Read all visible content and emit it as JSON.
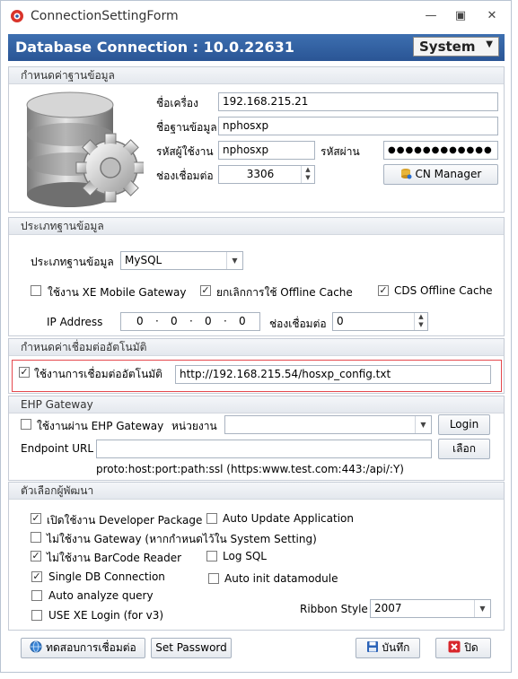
{
  "window": {
    "title": "ConnectionSettingForm",
    "banner_title": "Database Connection : 10.0.22631",
    "system_select": "System"
  },
  "db_settings": {
    "header": "กำหนดค่าฐานข้อมูล",
    "host_label": "ชื่อเครื่อง",
    "host_value": "192.168.215.21",
    "dbname_label": "ชื่อฐานข้อมูล",
    "dbname_value": "nphosxp",
    "user_label": "รหัสผู้ใช้งาน",
    "user_value": "nphosxp",
    "password_label": "รหัสผ่าน",
    "password_value": "●●●●●●●●●●●●",
    "port_label": "ช่องเชื่อมต่อ",
    "port_value": "3306",
    "cn_manager_button": "CN Manager"
  },
  "db_type": {
    "header": "ประเภทฐานข้อมูล",
    "type_label": "ประเภทฐานข้อมูล",
    "type_value": "MySQL",
    "xe_mobile_label": "ใช้งาน XE Mobile Gateway",
    "xe_mobile_checked": false,
    "cancel_offline_label": "ยกเลิกการใช้ Offline Cache",
    "cancel_offline_checked": true,
    "cds_offline_label": "CDS Offline Cache",
    "cds_offline_checked": true,
    "ip_label": "IP Address",
    "ip_octets": [
      "0",
      "0",
      "0",
      "0"
    ],
    "port_label": "ช่องเชื่อมต่อ",
    "port_value": "0"
  },
  "auto_config": {
    "header": "กำหนดค่าเชื่อมต่ออัตโนมัติ",
    "enable_label": "ใช้งานการเชื่อมต่ออัตโนมัติ",
    "enable_checked": true,
    "url_value": "http://192.168.215.54/hosxp_config.txt"
  },
  "ehp": {
    "header": "EHP Gateway",
    "use_label": "ใช้งานผ่าน EHP Gateway",
    "use_checked": false,
    "unit_label": "หน่วยงาน",
    "unit_value": "",
    "login_button": "Login",
    "endpoint_label": "Endpoint URL",
    "endpoint_value": "",
    "select_button": "เลือก",
    "hint": "proto:host:port:path:ssl (https:www.test.com:443:/api/:Y)"
  },
  "dev_options": {
    "header": "ตัวเลือกผู้พัฒนา",
    "items": [
      {
        "label": "เปิดใช้งาน Developer Package",
        "checked": true
      },
      {
        "label": "ไม่ใช้งาน Gateway (หากกำหนดไว้ใน System Setting)",
        "checked": false
      },
      {
        "label": "ไม่ใช้งาน BarCode Reader",
        "checked": true
      },
      {
        "label": "Single DB Connection",
        "checked": true
      },
      {
        "label": "Auto analyze query",
        "checked": false
      },
      {
        "label": "USE XE Login (for v3)",
        "checked": false
      },
      {
        "label": "Auto Update Application",
        "checked": false
      },
      {
        "label": "Log SQL",
        "checked": false
      },
      {
        "label": "Auto init datamodule",
        "checked": false
      }
    ],
    "ribbon_label": "Ribbon Style",
    "ribbon_value": "2007"
  },
  "footer": {
    "test_button": "ทดสอบการเชื่อมต่อ",
    "set_password_button": "Set Password",
    "save_button": "บันทึก",
    "close_button": "ปิด"
  },
  "colors": {
    "banner": "#2f5f9e",
    "highlight_border": "#e5484d"
  }
}
